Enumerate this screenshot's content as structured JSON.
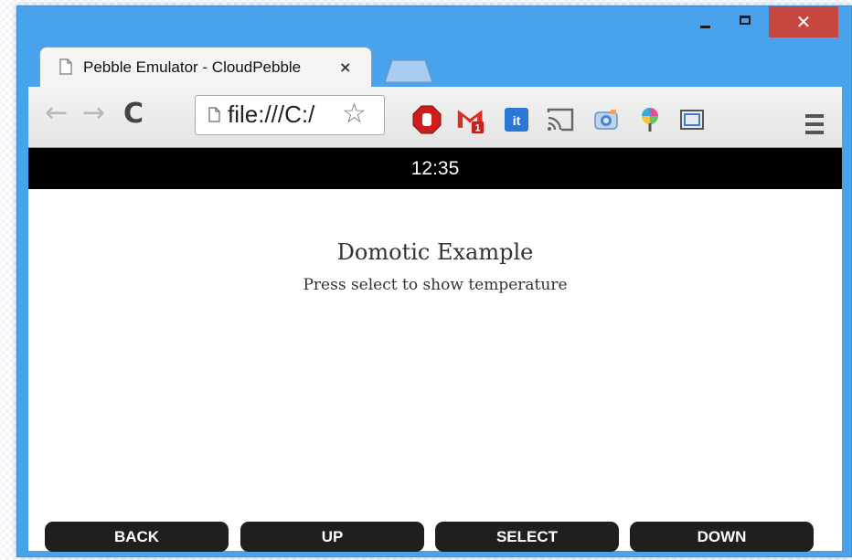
{
  "window": {
    "close_glyph": "✕"
  },
  "tab": {
    "title": "Pebble Emulator - CloudPebble",
    "close_glyph": "×"
  },
  "toolbar": {
    "back_glyph": "←",
    "forward_glyph": "→",
    "reload_glyph": "C",
    "url": "file:///C:/",
    "star_glyph": "☆",
    "extensions": [
      "adblock-icon",
      "gmail-icon",
      "it-icon",
      "cast-icon",
      "photo-icon",
      "color-picker-icon",
      "screenshot-icon"
    ],
    "gmail_badge": "1",
    "it_label": "it"
  },
  "pebble": {
    "time": "12:35",
    "title": "Domotic Example",
    "subtitle": "Press select to show temperature"
  },
  "buttons": {
    "back": "BACK",
    "up": "UP",
    "select": "SELECT",
    "down": "DOWN"
  },
  "colors": {
    "window_frame": "#49a2ec",
    "close_button": "#c7463f",
    "status_bar": "#000000",
    "button_bg": "#1f1f1f"
  }
}
